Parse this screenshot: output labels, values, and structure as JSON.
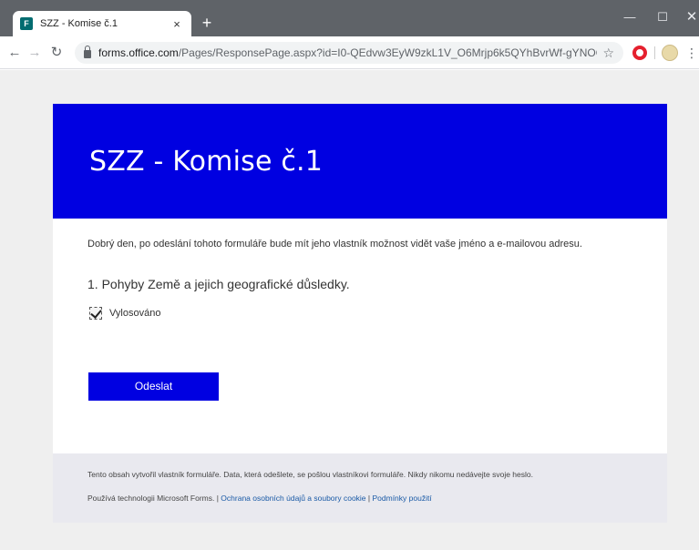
{
  "browser": {
    "tab_title": "SZZ - Komise č.1",
    "tab_close": "×",
    "new_tab": "+",
    "url_host": "forms.office.com",
    "url_path": "/Pages/ResponsePage.aspx?id=I0-QEdvw3EyW9zkL1V_O6Mrjp6k5QYhBvrWf-gYNOOJUNI...",
    "icons": {
      "back": "back-arrow-icon",
      "forward": "forward-arrow-icon",
      "reload": "reload-icon",
      "lock": "lock-icon",
      "star": "star-icon",
      "opera": "opera-icon",
      "avatar": "avatar-icon",
      "menu": "menu-dots-icon"
    }
  },
  "form": {
    "title": "SZZ - Komise č.1",
    "notice": "Dobrý den, po odeslání tohoto formuláře bude mít jeho vlastník možnost vidět vaše jméno a e-mailovou adresu.",
    "question": "1. Pohyby Země a jejich geografické důsledky.",
    "option_label": "Vylosováno",
    "option_checked": true,
    "submit_label": "Odeslat"
  },
  "footer": {
    "line1": "Tento obsah vytvořil vlastník formuláře. Data, která odešlete, se pošlou vlastníkovi formuláře. Nikdy nikomu nedávejte svoje heslo.",
    "powered_by": "Používá technologii Microsoft Forms. | ",
    "privacy_link": "Ochrana osobních údajů a soubory cookie",
    "separator": " | ",
    "terms_link": "Podmínky použití"
  },
  "colors": {
    "accent": "#0000e1",
    "page_bg": "#efefef",
    "footer_bg": "#e9e9ef",
    "chrome_dark": "#5f6368"
  }
}
